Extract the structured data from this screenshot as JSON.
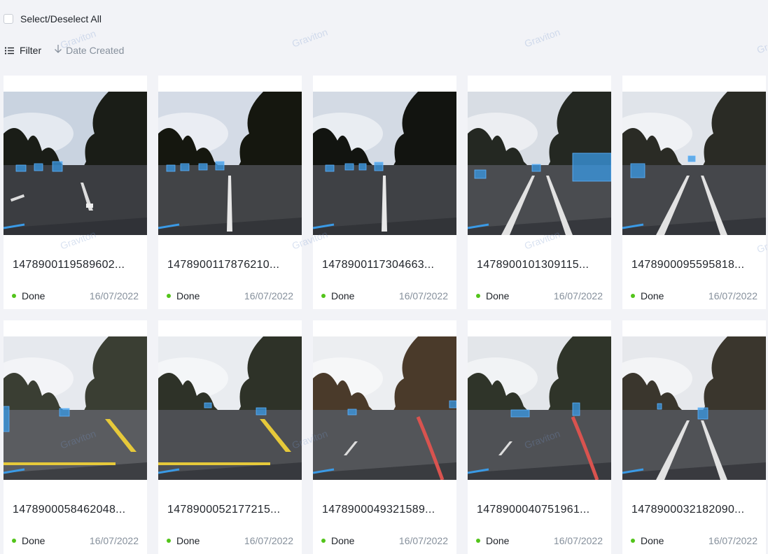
{
  "header": {
    "select_all_label": "Select/Deselect All",
    "filter_label": "Filter",
    "sort_label": "Date Created"
  },
  "watermark": "Graviton",
  "colors": {
    "background": "#f2f3f7",
    "card": "#ffffff",
    "status_done": "#52c41a",
    "muted_text": "#86909c",
    "annotation_box": "#3a9ae6"
  },
  "items": [
    {
      "name": "1478900119589602...",
      "status": "Done",
      "date": "16/07/2022"
    },
    {
      "name": "1478900117876210...",
      "status": "Done",
      "date": "16/07/2022"
    },
    {
      "name": "1478900117304663...",
      "status": "Done",
      "date": "16/07/2022"
    },
    {
      "name": "1478900101309115...",
      "status": "Done",
      "date": "16/07/2022"
    },
    {
      "name": "1478900095595818...",
      "status": "Done",
      "date": "16/07/2022"
    },
    {
      "name": "1478900058462048...",
      "status": "Done",
      "date": "16/07/2022"
    },
    {
      "name": "1478900052177215...",
      "status": "Done",
      "date": "16/07/2022"
    },
    {
      "name": "1478900049321589...",
      "status": "Done",
      "date": "16/07/2022"
    },
    {
      "name": "1478900040751961...",
      "status": "Done",
      "date": "16/07/2022"
    },
    {
      "name": "1478900032182090...",
      "status": "Done",
      "date": "16/07/2022"
    }
  ]
}
